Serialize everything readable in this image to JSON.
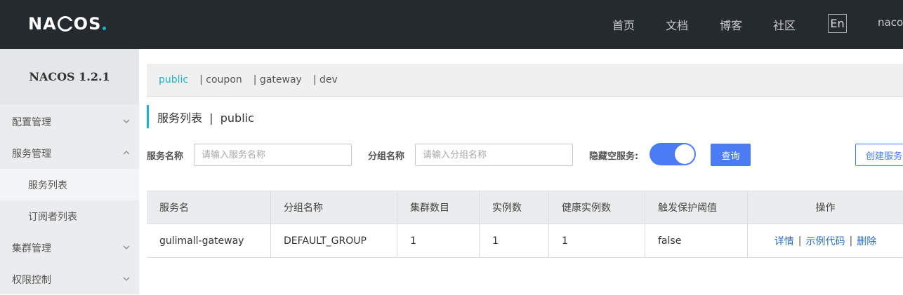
{
  "header": {
    "logo_text": "NACOS.",
    "nav": [
      "首页",
      "文档",
      "博客",
      "社区"
    ],
    "lang_label": "En",
    "user": "nacos"
  },
  "sidebar": {
    "title": "NACOS 1.2.1",
    "items": [
      {
        "label": "配置管理",
        "expanded": false
      },
      {
        "label": "服务管理",
        "expanded": true
      },
      {
        "label": "服务列表",
        "sub": true,
        "active": true
      },
      {
        "label": "订阅者列表",
        "sub": true
      },
      {
        "label": "集群管理",
        "expanded": false
      },
      {
        "label": "权限控制",
        "expanded": false
      }
    ]
  },
  "namespaces": [
    "public",
    "| coupon",
    "| gateway",
    "| dev"
  ],
  "page_title": "服务列表  |  public",
  "filters": {
    "service_label": "服务名称",
    "service_placeholder": "请输入服务名称",
    "group_label": "分组名称",
    "group_placeholder": "请输入分组名称",
    "hide_empty_label": "隐藏空服务:",
    "hide_empty_on": true,
    "query_button": "查询",
    "create_button": "创建服务"
  },
  "table": {
    "columns": [
      "服务名",
      "分组名称",
      "集群数目",
      "实例数",
      "健康实例数",
      "触发保护阈值",
      "操作"
    ],
    "rows": [
      {
        "service": "gulimall-gateway",
        "group": "DEFAULT_GROUP",
        "clusters": "1",
        "instances": "1",
        "healthy": "1",
        "threshold": "false",
        "actions": [
          "详情",
          "示例代码",
          "删除"
        ]
      }
    ]
  },
  "colors": {
    "topbar": "#252a2f",
    "accent": "#1ab4c8",
    "primary": "#4c7cf5",
    "link": "#2a6fc4"
  }
}
